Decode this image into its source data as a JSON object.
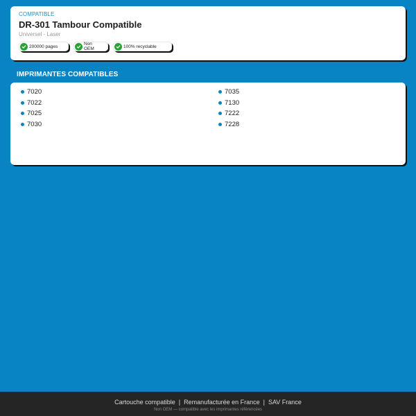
{
  "product": {
    "eyebrow": "COMPATIBLE",
    "title": "DR-301 Tambour Compatible",
    "subtitle": "Universel - Laser",
    "badges": [
      {
        "label": "200000 pages",
        "icon": "check-circle-icon"
      },
      {
        "label": "Non OEM",
        "icon": "check-circle-icon"
      },
      {
        "label": "100% recyclable",
        "icon": "check-circle-icon"
      }
    ]
  },
  "printers": {
    "title": "IMPRIMANTES COMPATIBLES",
    "left": [
      "7020",
      "7022",
      "7025",
      "7030"
    ],
    "right": [
      "7035",
      "7130",
      "7222",
      "7228"
    ]
  },
  "footer": {
    "links": [
      "Cartouche compatible",
      "Remanufacturée en France",
      "SAV France"
    ],
    "separator": "|",
    "note": "Non OEM — compatible avec les imprimantes référencées"
  },
  "colors": {
    "background": "#0884c4",
    "accent": "#1a8fc4",
    "check": "#27a532",
    "footer": "#252525"
  }
}
